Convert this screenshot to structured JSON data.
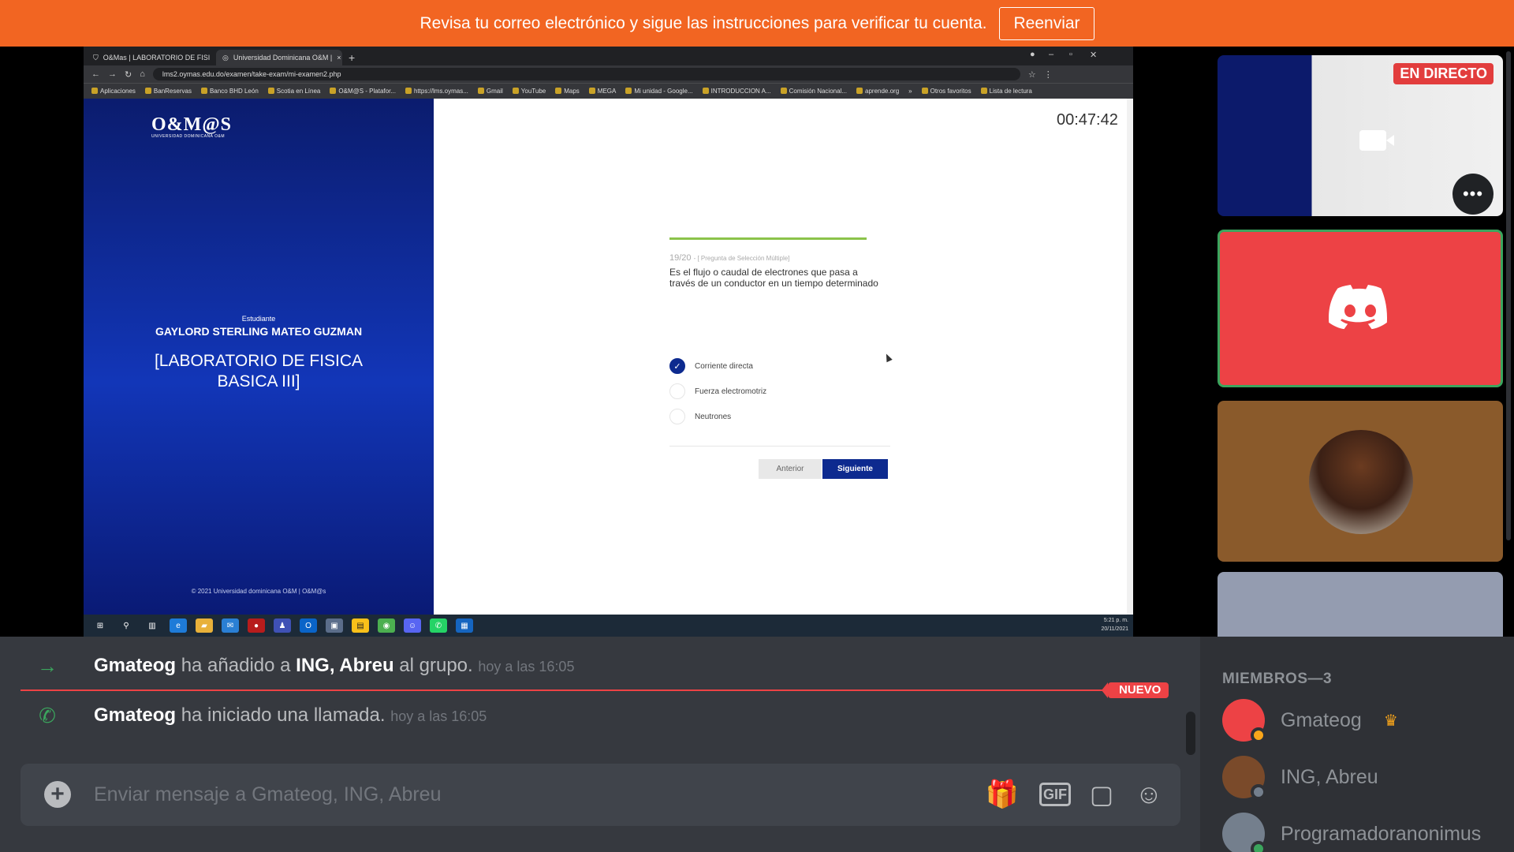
{
  "banner": {
    "message": "Revisa tu correo electrónico y sigue las instrucciones para verificar tu cuenta.",
    "button": "Reenviar"
  },
  "browser": {
    "tabs": [
      {
        "label": "O&Mas | LABORATORIO DE FISI",
        "close": "×"
      },
      {
        "label": "Universidad Dominicana O&M |",
        "close": "×"
      }
    ],
    "new_tab": "+",
    "url": "lms2.oymas.edu.do/examen/take-exam/mi-examen2.php",
    "bookmarks": [
      "Aplicaciones",
      "BanReservas",
      "Banco BHD León",
      "Scotia en Línea",
      "O&M@S - Platafor...",
      "https://lms.oymas...",
      "Gmail",
      "YouTube",
      "Maps",
      "MEGA",
      "Mi unidad - Google...",
      "INTRODUCCION A...",
      "Comisión Nacional...",
      "aprende.org",
      "»",
      "Otros favoritos",
      "Lista de lectura"
    ]
  },
  "exam": {
    "logo": "O&M@S",
    "logo_sub": "UNIVERSIDAD DOMINICANA O&M",
    "student_label": "Estudiante",
    "student_name": "GAYLORD STERLING MATEO GUZMAN",
    "course": "[LABORATORIO DE FISICA BASICA III]",
    "copyright": "© 2021 Universidad dominicana O&M | O&M@s",
    "timer": "00:47:42",
    "question_number": "19/20",
    "question_type": "- [ Pregunta de Selección Múltiple]",
    "question_text": "Es el flujo o caudal de electrones que pasa a través de un conductor en un tiempo determinado",
    "options": [
      {
        "label": "Corriente directa",
        "checked": true
      },
      {
        "label": "Fuerza electromotriz",
        "checked": false
      },
      {
        "label": "Neutrones",
        "checked": false
      }
    ],
    "prev_button": "Anterior",
    "next_button": "Siguiente"
  },
  "taskbar": {
    "time": "5:21 p. m.",
    "date": "20/11/2021"
  },
  "tiles": {
    "live_badge": "EN DIRECTO",
    "more": "•••"
  },
  "chat": {
    "messages": [
      {
        "type": "join",
        "user": "Gmateog",
        "action1": "ha añadido a",
        "target": "ING, Abreu",
        "action2": "al grupo.",
        "time": "hoy a las 16:05"
      },
      {
        "type": "call",
        "user": "Gmateog",
        "action1": "ha iniciado una llamada.",
        "time": "hoy a las 16:05"
      }
    ],
    "new_badge": "NUEVO",
    "input_placeholder": "Enviar mensaje a Gmateog, ING, Abreu",
    "gif_label": "GIF"
  },
  "members": {
    "header": "MIEMBROS—3",
    "list": [
      {
        "name": "Gmateog",
        "owner": true,
        "avatar_color": "#ed4245",
        "status_color": "#faa61a"
      },
      {
        "name": "ING, Abreu",
        "owner": false,
        "avatar_color": "#7a4a2a",
        "status_color": "#747f8d"
      },
      {
        "name": "Programadoranonimus",
        "owner": false,
        "avatar_color": "#747f8d",
        "status_color": "#3ba55d"
      }
    ]
  },
  "colors": {
    "banner": "#f26522",
    "discord_red": "#ed4245",
    "speaking_green": "#3ba55d",
    "exam_blue": "#0d2a8f"
  }
}
